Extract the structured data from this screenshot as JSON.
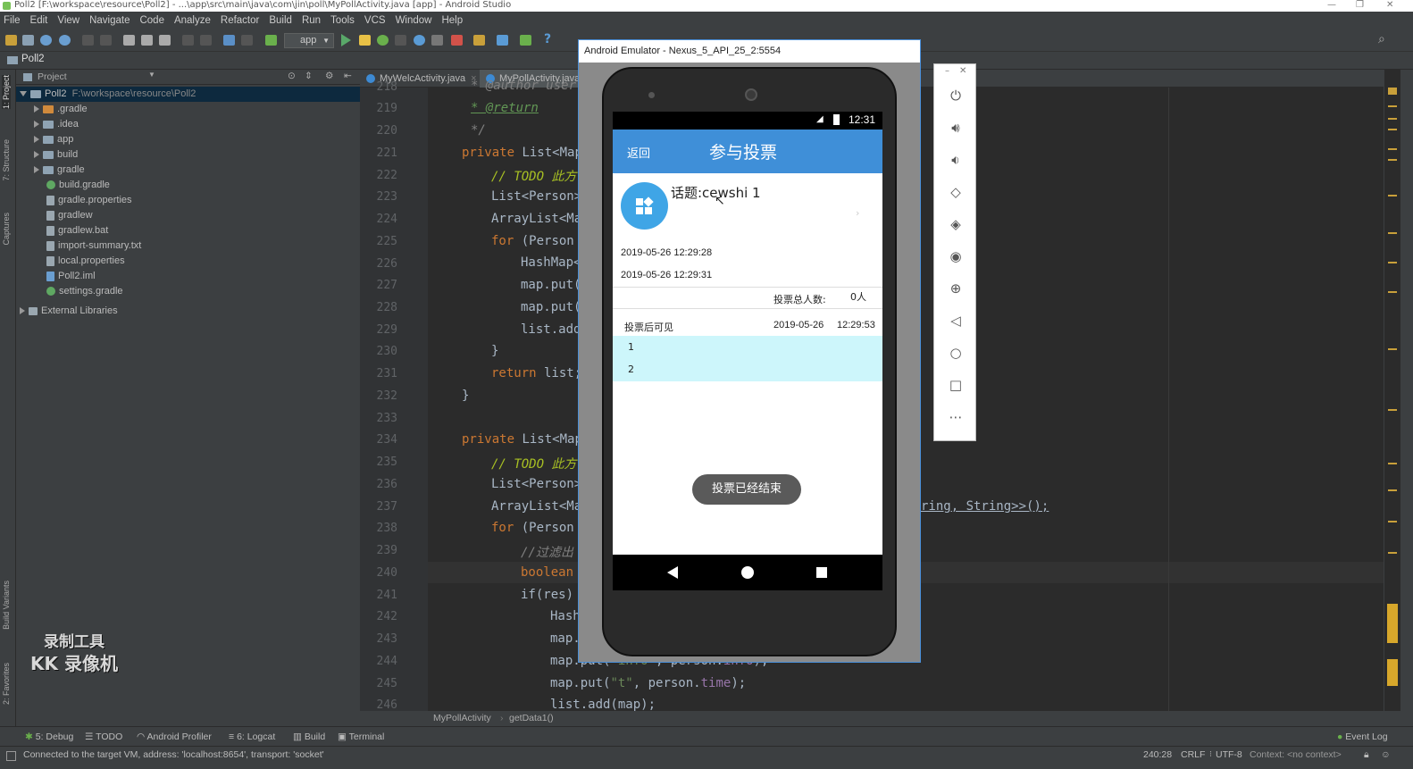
{
  "window": {
    "title": "Poll2 [F:\\workspace\\resource\\Poll2] - ...\\app\\src\\main\\java\\com\\jin\\poll\\MyPollActivity.java [app] - Android Studio"
  },
  "menu": [
    "File",
    "Edit",
    "View",
    "Navigate",
    "Code",
    "Analyze",
    "Refactor",
    "Build",
    "Run",
    "Tools",
    "VCS",
    "Window",
    "Help"
  ],
  "toolbar": {
    "run_config": "app"
  },
  "nav": {
    "project": "Poll2"
  },
  "left_tabs": {
    "project": "1: Project",
    "structure": "7: Structure",
    "captures": "Captures",
    "build_variants": "Build Variants",
    "favorites": "2: Favorites"
  },
  "project_panel": {
    "header": "Project",
    "root": {
      "name": "Poll2",
      "path": "F:\\workspace\\resource\\Poll2"
    },
    "items": [
      ".gradle",
      ".idea",
      "app",
      "build",
      "gradle",
      "build.gradle",
      "gradle.properties",
      "gradlew",
      "gradlew.bat",
      "import-summary.txt",
      "local.properties",
      "Poll2.iml",
      "settings.gradle"
    ],
    "external": "External Libraries"
  },
  "editor": {
    "tabs": [
      "MyWelcActivity.java",
      "MyPollActivity.java"
    ],
    "line_numbers": [
      "218",
      "219",
      "220",
      "221",
      "222",
      "223",
      "224",
      "225",
      "226",
      "227",
      "228",
      "229",
      "230",
      "231",
      "232",
      "233",
      "234",
      "235",
      "236",
      "237",
      "238",
      "239",
      "240",
      "241",
      "242",
      "243",
      "244",
      "245",
      "246"
    ],
    "code": {
      "l218": "* @author user",
      "l219": "* @return",
      "l220": "*/",
      "l221a": "private",
      "l221b": " List<Map",
      "l222": "// TODO 此方",
      "l223": "List<Person>",
      "l224": "ArrayList<Ma",
      "l225a": "for",
      "l225b": " (Person",
      "l226": "HashMap<",
      "l227": "map.put(",
      "l228": "map.put(",
      "l229": "list.add",
      "l230": "}",
      "l231a": "return",
      "l231b": " list;",
      "l232": "}",
      "l234a": "private",
      "l234b": " List<Map",
      "l235": "// TODO 此方",
      "l236": "List<Person>",
      "l237": "ArrayList<Ma",
      "l237r": "ring, String>>();",
      "l238a": "for",
      "l238b": " (Person",
      "l239": "//过滤出",
      "l240": "boolean",
      "l241": "if(res) {",
      "l242": "Hash",
      "l243": "map.",
      "l244a": "map.put(",
      "l244b": "\"info\"",
      "l244c": ", person.",
      "l244d": "info",
      "l244e": ");",
      "l245a": "map.put(",
      "l245b": "\"t\"",
      "l245c": ", person.",
      "l245d": "time",
      "l245e": ");",
      "l246": "list.add(map);"
    }
  },
  "breadcrumb": {
    "class": "MyPollActivity",
    "method": "getData1()"
  },
  "bottom_tabs": [
    "5: Debug",
    "TODO",
    "Android Profiler",
    "6: Logcat",
    "Build",
    "Terminal"
  ],
  "event_log": "Event Log",
  "status": {
    "message": "Connected to the target VM, address: 'localhost:8654', transport: 'socket'",
    "position": "240:28",
    "line_sep": "CRLF",
    "encoding": "UTF-8",
    "context": "Context: <no context>"
  },
  "watermark": {
    "line1": "录制工具",
    "line2": "KK 录像机"
  },
  "emulator": {
    "title": "Android Emulator - Nexus_5_API_25_2:5554",
    "time": "12:31",
    "back_label": "返回",
    "app_title": "参与投票",
    "topic": "话题:cewshi 1",
    "start_time": "2019-05-26 12:29:28",
    "end_time": "2019-05-26 12:29:31",
    "total_label": "投票总人数:",
    "total_value": "0人",
    "visibility": "投票后可见",
    "vote_date": "2019-05-26",
    "vote_time": "12:29:53",
    "options": [
      "1",
      "2"
    ],
    "ended_button": "投票已经结束"
  },
  "colors": {
    "accent": "#3f8fd8",
    "options_bg": "#cdf6fb",
    "ended_btn": "#5a5a5a"
  }
}
